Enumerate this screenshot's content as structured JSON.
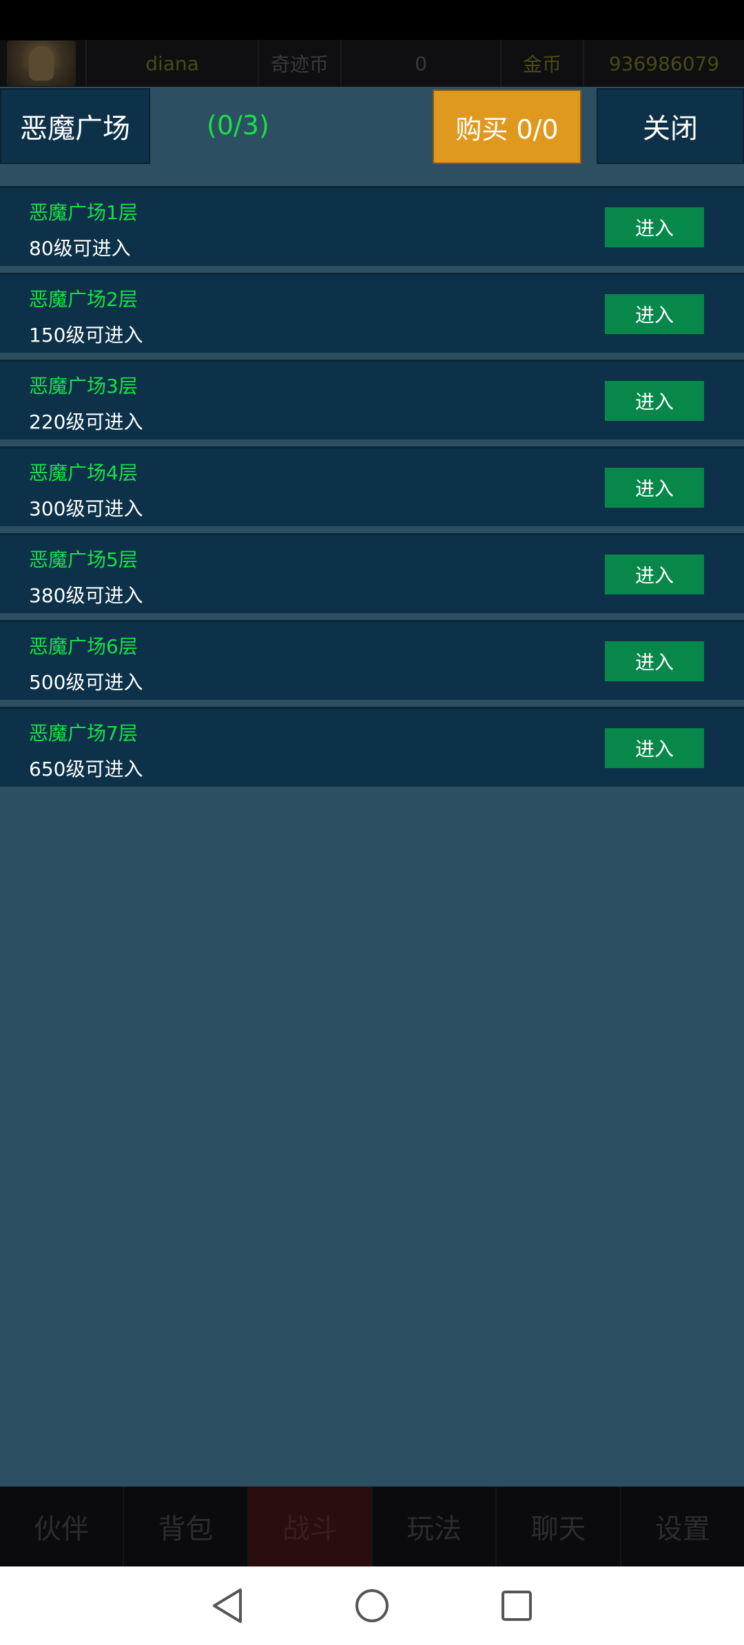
{
  "top_info": {
    "username": "diana",
    "currency1_label": "奇迹币",
    "currency1_value": "0",
    "currency2_label": "金币",
    "currency2_value": "936986079"
  },
  "dialog": {
    "title": "恶魔广场",
    "count": "(0/3)",
    "buy_label": "购买 0/0",
    "close_label": "关闭"
  },
  "floors": [
    {
      "name": "恶魔广场1层",
      "requirement": "80级可进入",
      "button": "进入"
    },
    {
      "name": "恶魔广场2层",
      "requirement": "150级可进入",
      "button": "进入"
    },
    {
      "name": "恶魔广场3层",
      "requirement": "220级可进入",
      "button": "进入"
    },
    {
      "name": "恶魔广场4层",
      "requirement": "300级可进入",
      "button": "进入"
    },
    {
      "name": "恶魔广场5层",
      "requirement": "380级可进入",
      "button": "进入"
    },
    {
      "name": "恶魔广场6层",
      "requirement": "500级可进入",
      "button": "进入"
    },
    {
      "name": "恶魔广场7层",
      "requirement": "650级可进入",
      "button": "进入"
    }
  ],
  "tabs": [
    "伙伴",
    "背包",
    "战斗",
    "玩法",
    "聊天",
    "设置"
  ],
  "icons": {
    "back": "back-triangle-icon",
    "home": "home-circle-icon",
    "recents": "recents-square-icon"
  },
  "colors": {
    "accent_green": "#19e04a",
    "buy_orange": "#e0991f",
    "enter_green": "#07884a",
    "panel_bg": "#2c4f62",
    "row_bg": "#0c3148"
  }
}
